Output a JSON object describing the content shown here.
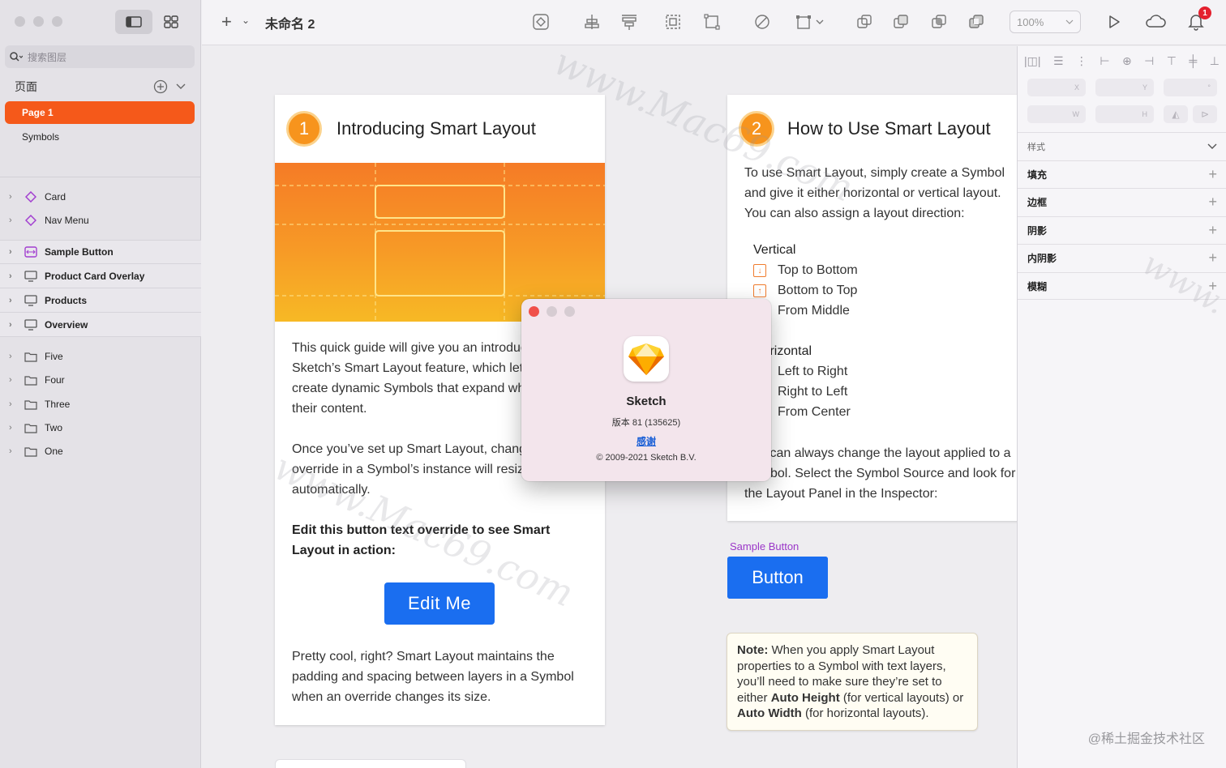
{
  "sidebar": {
    "search_placeholder": "搜索图层",
    "pages_label": "页面",
    "pages": [
      "Page 1",
      "Symbols"
    ],
    "symbol_layers": [
      {
        "label": "Card",
        "icon": "symbol-diamond-icon"
      },
      {
        "label": "Nav Menu",
        "icon": "symbol-diamond-icon"
      }
    ],
    "artboards": [
      {
        "label": "Sample Button",
        "icon": "symbol-source-icon"
      },
      {
        "label": "Product Card Overlay",
        "icon": "artboard-icon"
      },
      {
        "label": "Products",
        "icon": "artboard-icon"
      },
      {
        "label": "Overview",
        "icon": "artboard-icon"
      }
    ],
    "groups": [
      "Five",
      "Four",
      "Three",
      "Two",
      "One"
    ]
  },
  "toolbar": {
    "doc_title": "未命名 2",
    "zoom": "100%",
    "notification_count": "1"
  },
  "card1": {
    "number": "1",
    "title": "Introducing Smart Layout",
    "para1": "This quick guide will give you an introduction to Sketch’s Smart Layout feature, which lets you create dynamic Symbols that expand when you edit their content.",
    "para2": "Once you’ve set up Smart Layout, changing an override in a Symbol’s instance will resize it automatically.",
    "cta": "Edit this button text override to see Smart Layout in action:",
    "button": "Edit Me",
    "para3": "Pretty cool, right? Smart Layout maintains the padding and spacing between layers in a Symbol when an override changes its size."
  },
  "card2": {
    "number": "2",
    "title": "How to Use Smart Layout",
    "intro": "To use Smart Layout, simply create a Symbol and give it either horizontal or vertical layout. You can also assign a layout direction:",
    "vertical_head": "Vertical",
    "vertical": [
      "Top to Bottom",
      "Bottom to Top",
      "From Middle"
    ],
    "horizontal_head": "Horizontal",
    "horizontal": [
      "Left to Right",
      "Right to Left",
      "From Center"
    ],
    "outro": "You can always change the layout applied to a Symbol. Select the Symbol Source and look for the Layout Panel in the Inspector:"
  },
  "sample": {
    "label": "Sample Button",
    "button": "Button"
  },
  "note": {
    "lead": "Note:",
    "t1": " When you apply Smart Layout properties to a Symbol with text layers, you’ll need to make sure they’re set to either ",
    "b1": "Auto Height",
    "t2": " (for vertical layouts) or ",
    "b2": "Auto Width",
    "t3": " (for horizontal layouts)."
  },
  "about": {
    "app_name": "Sketch",
    "version": "版本 81 (135625)",
    "thanks": "感谢",
    "copyright": "© 2009-2021 Sketch B.V."
  },
  "inspector": {
    "x": "X",
    "y": "Y",
    "rotation": "°",
    "w": "W",
    "h": "H",
    "styles_label": "样式",
    "sections": [
      "填充",
      "边框",
      "阴影",
      "内阴影",
      "模糊"
    ]
  },
  "watermarks": [
    "www.Mac69.com",
    "www.Mac69.com",
    "www."
  ],
  "credit": "@稀土掘金技术社区",
  "colors": {
    "accent": "#f5591a",
    "button_blue": "#1a6ef0",
    "symbol_purple": "#9b37c8",
    "hero_orange": "#f7941d"
  }
}
